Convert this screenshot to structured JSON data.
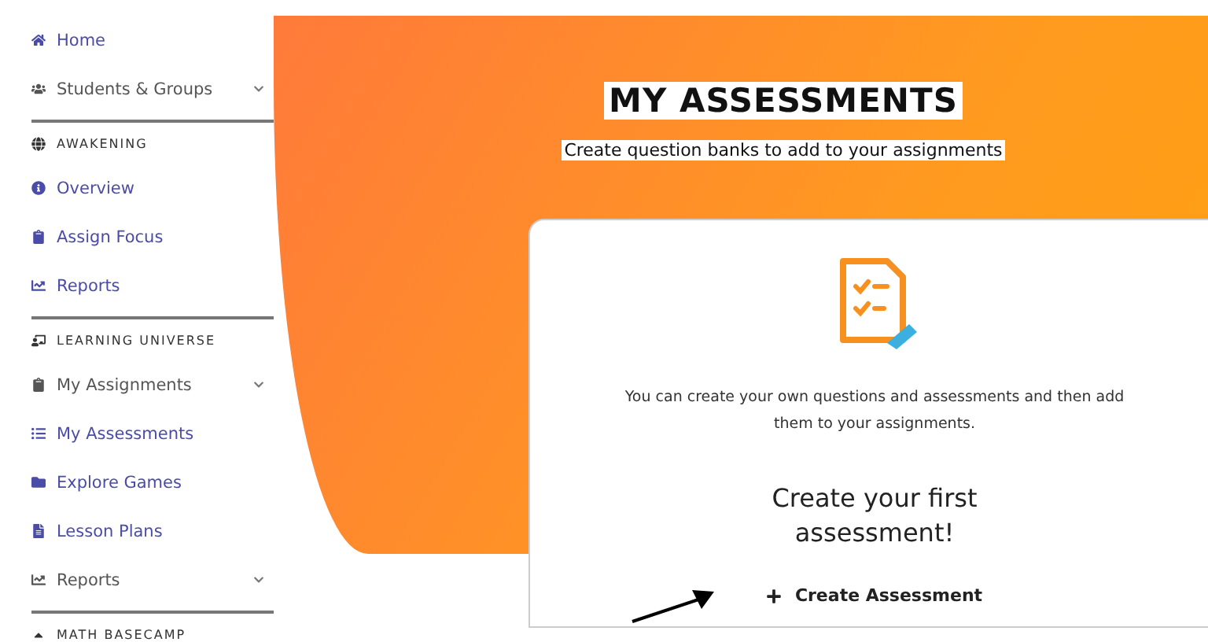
{
  "sidebar": {
    "items": [
      {
        "kind": "item",
        "label": "Home",
        "expandable": false
      },
      {
        "kind": "item",
        "label": "Students & Groups",
        "expandable": true
      },
      {
        "kind": "section",
        "label": "AWAKENING"
      },
      {
        "kind": "item",
        "label": "Overview",
        "expandable": false
      },
      {
        "kind": "item",
        "label": "Assign Focus",
        "expandable": false
      },
      {
        "kind": "item",
        "label": "Reports",
        "expandable": false
      },
      {
        "kind": "section",
        "label": "LEARNING UNIVERSE"
      },
      {
        "kind": "item",
        "label": "My Assignments",
        "expandable": true
      },
      {
        "kind": "item",
        "label": "My Assessments",
        "expandable": false
      },
      {
        "kind": "item",
        "label": "Explore Games",
        "expandable": false
      },
      {
        "kind": "item",
        "label": "Lesson Plans",
        "expandable": false
      },
      {
        "kind": "item",
        "label": "Reports",
        "expandable": true
      },
      {
        "kind": "section",
        "label": "MATH BASECAMP"
      }
    ]
  },
  "header": {
    "title": "MY ASSESSMENTS",
    "subtitle": "Create question banks to add to your assignments"
  },
  "card": {
    "description": "You can create your own questions and assessments and then add them to your assignments.",
    "heading": "Create your first assessment!",
    "button": "Create Assessment"
  }
}
